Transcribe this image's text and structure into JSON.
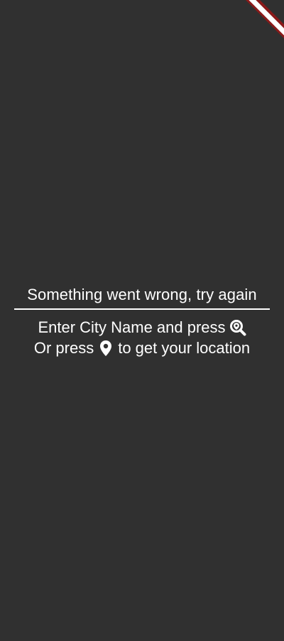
{
  "colors": {
    "background": "#303030",
    "text": "#ffffff",
    "banner_red": "#8b1a1a"
  },
  "message": {
    "error": "Something went wrong, try again"
  },
  "hints": {
    "line1_text": "Enter City Name and press",
    "line1_icon": "search-location-icon",
    "line2_prefix": "Or press",
    "line2_icon": "location-pin-icon",
    "line2_suffix": "to get your location"
  }
}
